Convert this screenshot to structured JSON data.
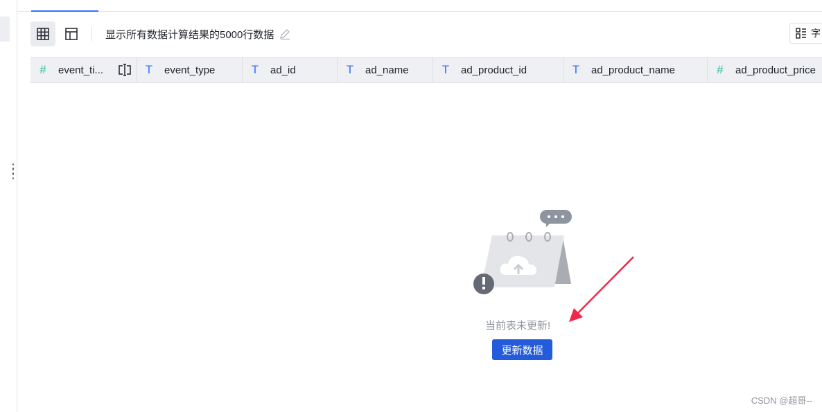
{
  "toolbar": {
    "description": "显示所有数据计算结果的5000行数据",
    "field_button_label": "字"
  },
  "columns": [
    {
      "name": "event_ti...",
      "type": "number"
    },
    {
      "name": "event_type",
      "type": "text"
    },
    {
      "name": "ad_id",
      "type": "text"
    },
    {
      "name": "ad_name",
      "type": "text"
    },
    {
      "name": "ad_product_id",
      "type": "text"
    },
    {
      "name": "ad_product_name",
      "type": "text"
    },
    {
      "name": "ad_product_price",
      "type": "number"
    }
  ],
  "empty_state": {
    "message": "当前表未更新!",
    "button_label": "更新数据"
  },
  "watermark": "CSDN @超哥--",
  "colors": {
    "accent": "#3370ff",
    "button": "#245bdb",
    "number_icon": "#2bb5a2",
    "arrow": "#f0264b"
  },
  "icons": {
    "grid_view": "grid-icon",
    "layout_view": "layout-icon",
    "edit": "edit-pencil-icon",
    "number_type": "hash-icon",
    "text_type": "text-t-icon"
  }
}
